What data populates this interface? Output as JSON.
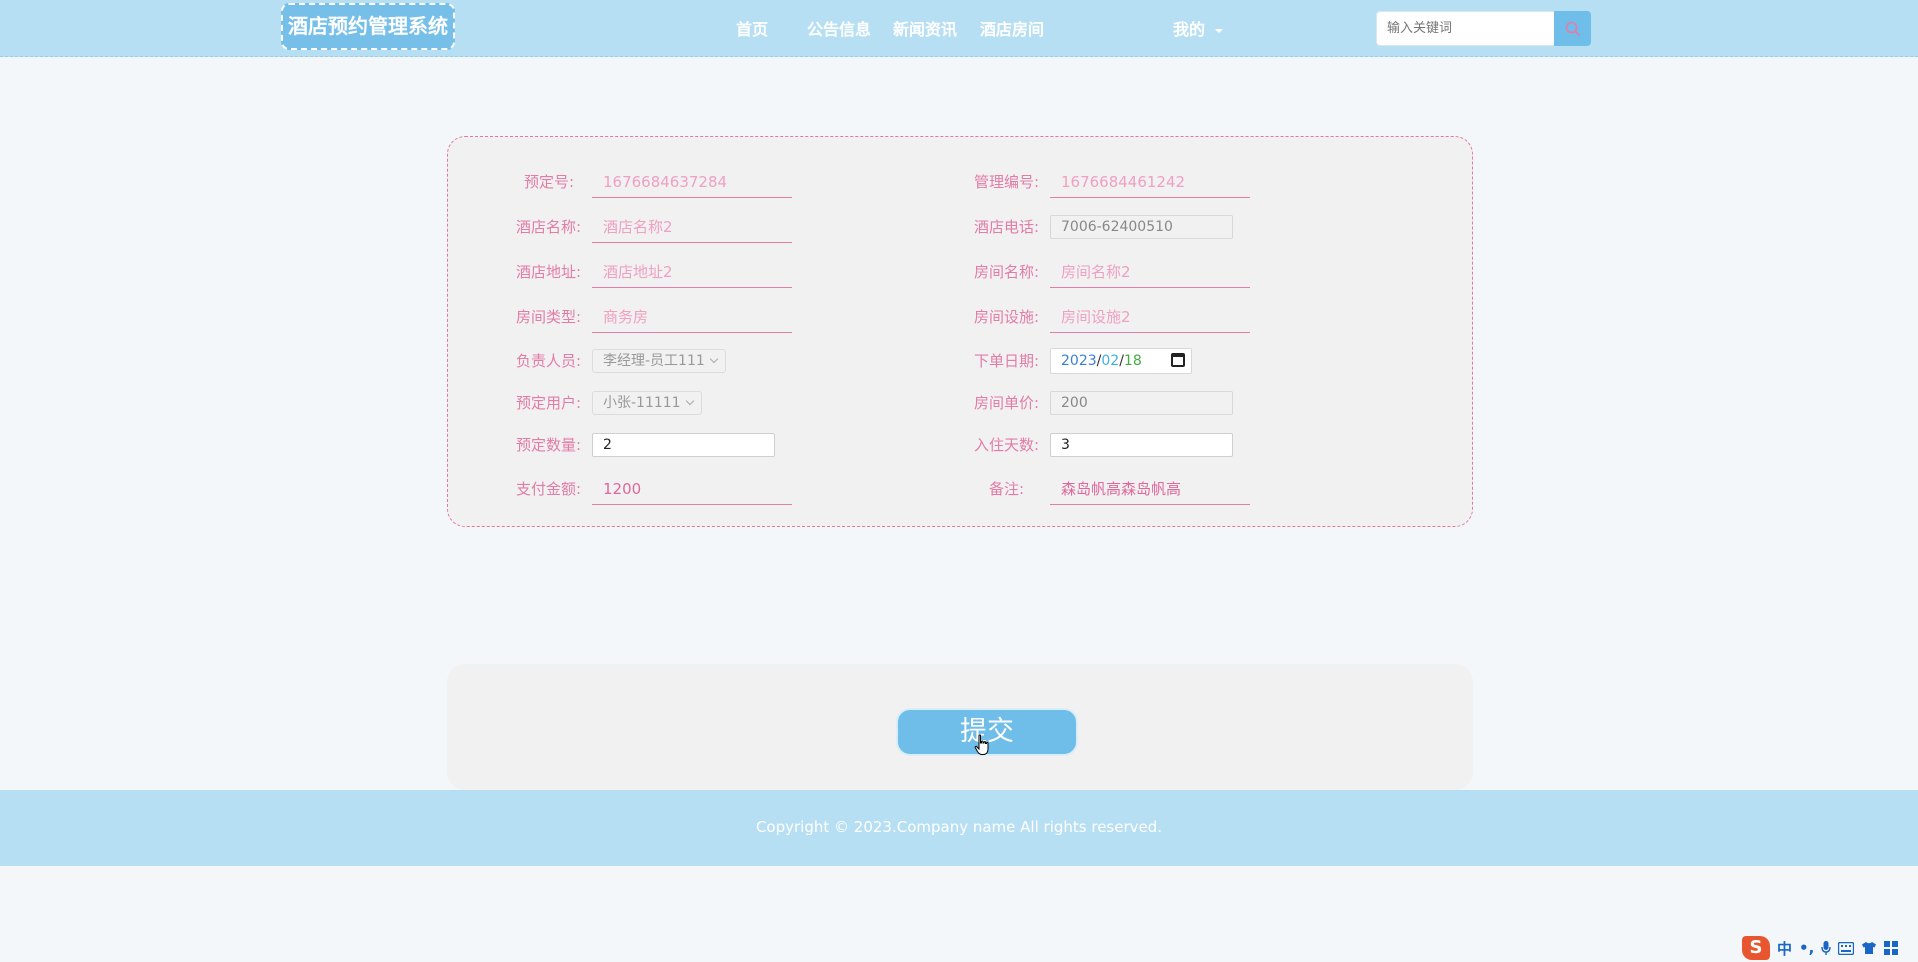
{
  "header": {
    "logo": "酒店预约管理系统",
    "nav": [
      {
        "label": "首页",
        "name": "nav-home"
      },
      {
        "label": "公告信息",
        "name": "nav-announcements"
      },
      {
        "label": "新闻资讯",
        "name": "nav-news"
      },
      {
        "label": "酒店房间",
        "name": "nav-hotel-rooms"
      }
    ],
    "mine": "我的",
    "search_placeholder": "输入关键词"
  },
  "form": {
    "booking_no_label": "预定号:",
    "booking_no": "1676684637284",
    "manager_no_label": "管理编号:",
    "manager_no": "1676684461242",
    "hotel_name_label": "酒店名称:",
    "hotel_name": "酒店名称2",
    "hotel_phone_label": "酒店电话:",
    "hotel_phone": "7006-62400510",
    "hotel_address_label": "酒店地址:",
    "hotel_address": "酒店地址2",
    "room_name_label": "房间名称:",
    "room_name": "房间名称2",
    "room_type_label": "房间类型:",
    "room_type": "商务房",
    "room_facilities_label": "房间设施:",
    "room_facilities": "房间设施2",
    "staff_label": "负责人员:",
    "staff": "李经理-员工111",
    "order_date_label": "下单日期:",
    "order_date": {
      "year": "2023",
      "month": "02",
      "day": "18"
    },
    "user_label": "预定用户:",
    "user": "小张-11111",
    "unit_price_label": "房间单价:",
    "unit_price": "200",
    "quantity_label": "预定数量:",
    "quantity": "2",
    "nights_label": "入住天数:",
    "nights": "3",
    "amount_label": "支付金额:",
    "amount": "1200",
    "remark_label": "备注:",
    "remark": "森岛帆高森岛帆高"
  },
  "submit_label": "提交",
  "footer": {
    "copyright": "Copyright © 2023.Company name All rights reserved."
  },
  "tray": {
    "logo": "S",
    "ime_lang": "中",
    "punct": "•,"
  },
  "colors": {
    "header_bg": "#b7dff3",
    "accent_blue": "#6fbde9",
    "accent_pink": "#e37ca7"
  }
}
